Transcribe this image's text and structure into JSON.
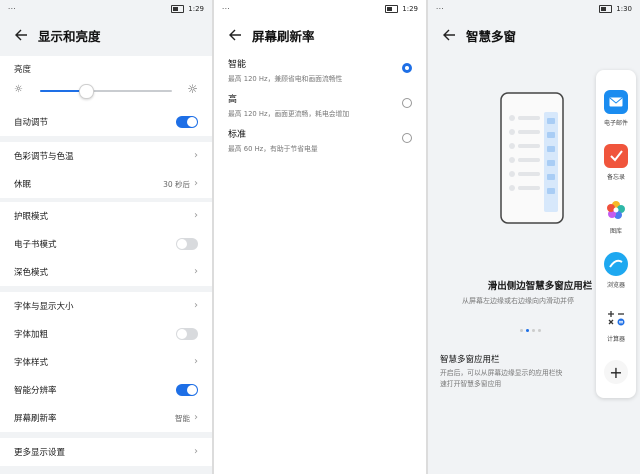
{
  "status_left": "···",
  "panel1": {
    "time": "1:29",
    "title": "显示和亮度",
    "brightness_label": "亮度",
    "brightness_level": 0.35,
    "rows": {
      "auto": "自动调节",
      "color": "色彩调节与色温",
      "sleep": "休眠",
      "sleep_value": "30 秒后",
      "eye": "护眼模式",
      "ebook": "电子书模式",
      "dark": "深色模式",
      "fontsize": "字体与显示大小",
      "bold": "字体加粗",
      "fontstyle": "字体样式",
      "smartres": "智能分辨率",
      "refresh": "屏幕刷新率",
      "refresh_value": "智能",
      "more": "更多显示设置"
    }
  },
  "panel2": {
    "time": "1:29",
    "title": "屏幕刷新率",
    "options": [
      {
        "title": "智能",
        "desc": "最高 120 Hz，兼顾省电和画面流畅性",
        "selected": true
      },
      {
        "title": "高",
        "desc": "最高 120 Hz，画面更流畅，耗电会增加",
        "selected": false
      },
      {
        "title": "标准",
        "desc": "最高 60 Hz，有助于节省电量",
        "selected": false
      }
    ]
  },
  "panel3": {
    "time": "1:30",
    "title": "智慧多窗",
    "headline": "滑出侧边智慧多窗应用栏",
    "sub": "从屏幕左边缘或右边缘向内滑动并停",
    "section_title": "智慧多窗应用栏",
    "section_desc_1": "开启后，可以从屏幕边缘显示的应用栏快",
    "section_desc_2": "速打开智慧多窗应用",
    "dock_apps": [
      {
        "name": "电子邮件",
        "icon": "mail-icon",
        "color": "#1a8cf0"
      },
      {
        "name": "备忘录",
        "icon": "memo-icon",
        "color": "#f0553c"
      },
      {
        "name": "图库",
        "icon": "gallery-icon",
        "color": "#ffffff"
      },
      {
        "name": "浏览器",
        "icon": "browser-icon",
        "color": "#1ea8f0"
      },
      {
        "name": "计算器",
        "icon": "calculator-icon",
        "color": "#ffffff"
      }
    ],
    "add_symbol": "+"
  }
}
